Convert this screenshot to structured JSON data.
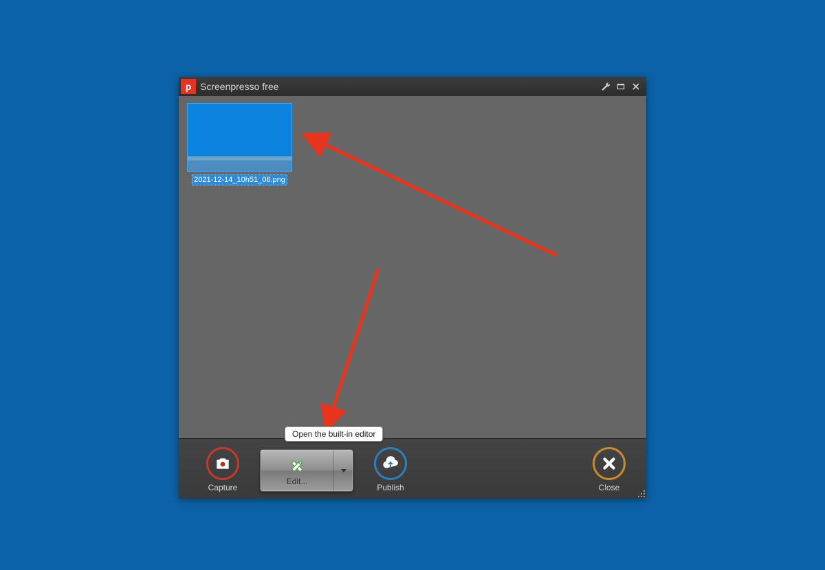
{
  "window": {
    "title": "Screenpresso free",
    "app_icon_letter": "p"
  },
  "gallery": {
    "items": [
      {
        "filename": "2021-12-14_10h51_06.png"
      }
    ]
  },
  "toolbar": {
    "capture_label": "Capture",
    "edit_label": "Edit...",
    "publish_label": "Publish",
    "close_label": "Close",
    "edit_tooltip": "Open the built-in editor"
  },
  "icons": {
    "wrench": "wrench-icon",
    "maximize": "maximize-icon",
    "close_win": "close-icon",
    "camera": "camera-icon",
    "edit": "edit-pencil-ruler-icon",
    "dropdown": "chevron-down-icon",
    "cloud_up": "cloud-upload-icon",
    "close_x": "x-icon",
    "grip": "resize-grip-icon"
  },
  "colors": {
    "desktop": "#0c62a7",
    "window_body": "#666666",
    "titlebar": "#333333",
    "accent_red": "#c23a2c",
    "accent_blue": "#2e7fb9",
    "accent_orange": "#c88a2f",
    "arrow": "#e8341c",
    "thumb_selected": "#2f8ad8"
  },
  "annotations": {
    "arrow1_target": "screenshot-thumbnail",
    "arrow2_target": "edit-button"
  }
}
